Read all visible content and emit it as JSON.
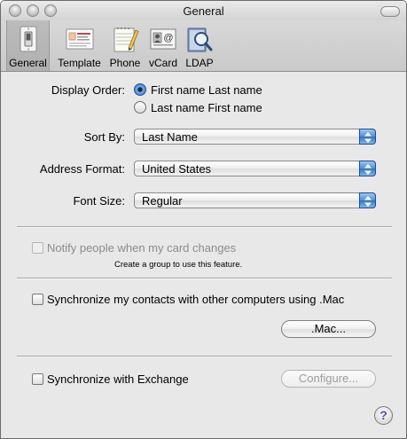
{
  "window": {
    "title": "General"
  },
  "toolbar": {
    "items": [
      {
        "label": "General",
        "icon": "light-switch-icon",
        "selected": true
      },
      {
        "label": "Template",
        "icon": "template-card-icon",
        "selected": false
      },
      {
        "label": "Phone",
        "icon": "notepad-pencil-icon",
        "selected": false
      },
      {
        "label": "vCard",
        "icon": "vcard-icon",
        "selected": false
      },
      {
        "label": "LDAP",
        "icon": "ldap-globe-icon",
        "selected": false
      }
    ]
  },
  "display_order": {
    "label": "Display Order:",
    "options": [
      {
        "label": "First name Last name",
        "selected": true
      },
      {
        "label": "Last name First name",
        "selected": false
      }
    ]
  },
  "sort_by": {
    "label": "Sort By:",
    "value": "Last Name"
  },
  "address_format": {
    "label": "Address Format:",
    "value": "United States"
  },
  "font_size": {
    "label": "Font Size:",
    "value": "Regular"
  },
  "notify": {
    "label": "Notify people when my card changes",
    "checked": false,
    "enabled": false,
    "note": "Create a group to use this feature."
  },
  "sync_mac": {
    "label": "Synchronize my contacts with other computers using .Mac",
    "checked": false,
    "button_label": ".Mac..."
  },
  "sync_exchange": {
    "label": "Synchronize with Exchange",
    "checked": false,
    "button_label": "Configure..."
  },
  "colors": {
    "accent": "#3d7ad1",
    "window_bg": "#e8e8e8",
    "help_glyph": "#6a3fb0"
  },
  "help": {
    "glyph": "?"
  }
}
